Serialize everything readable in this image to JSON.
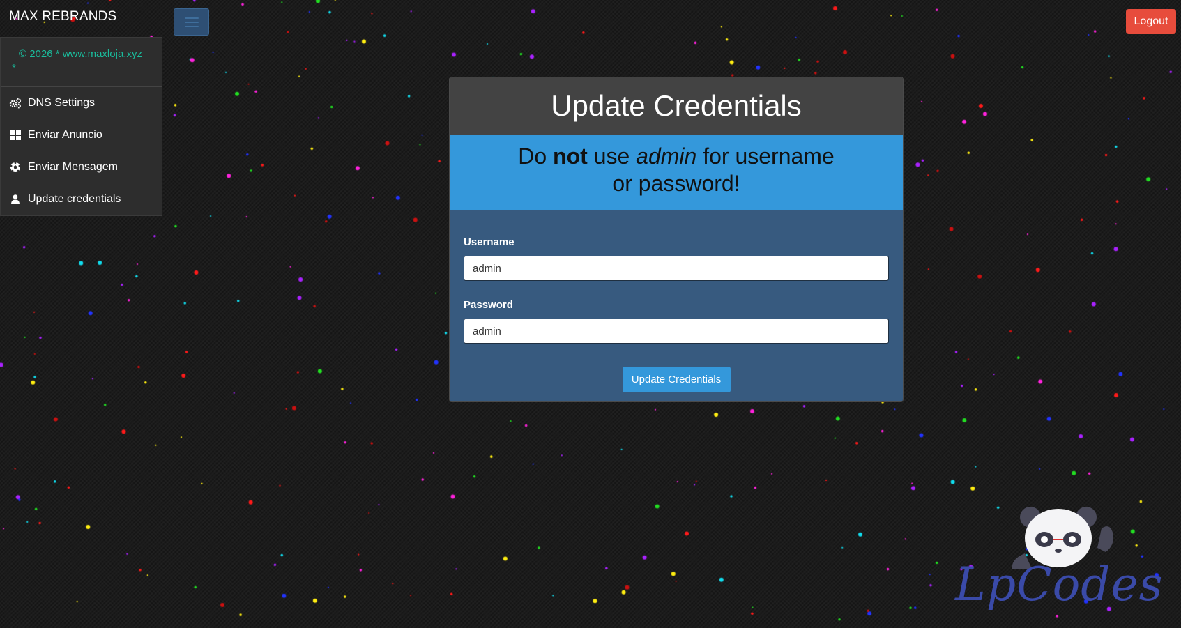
{
  "brand": {
    "title": "MAX REBRANDS"
  },
  "topbar": {
    "logout_label": "Logout"
  },
  "sidebar": {
    "copyright_line1": "© 2026 * www.maxloja.xyz",
    "copyright_line2": "*",
    "items": [
      {
        "label": "DNS Settings",
        "icon": "gears-icon"
      },
      {
        "label": "Enviar Anuncio",
        "icon": "grid-icon"
      },
      {
        "label": "Enviar Mensagem",
        "icon": "soccer-ball-icon"
      },
      {
        "label": "Update credentials",
        "icon": "user-icon"
      }
    ]
  },
  "panel": {
    "title": "Update Credentials",
    "alert": {
      "part1": "Do ",
      "bold": "not",
      "part2": " use ",
      "italic": "admin",
      "part3": " for username or password!"
    },
    "username_label": "Username",
    "username_value": "admin",
    "password_label": "Password",
    "password_value": "admin",
    "submit_label": "Update Credentials"
  },
  "watermark": {
    "text": "LpCodes"
  },
  "colors": {
    "accent": "#3498db",
    "panel_body": "#375a7f",
    "logout": "#e74c3c",
    "copyright": "#1abc9c",
    "watermark": "#3a4aa8"
  }
}
